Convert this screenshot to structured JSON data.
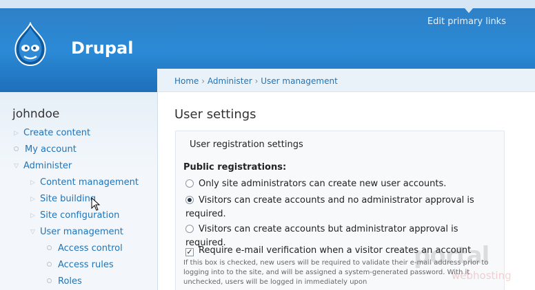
{
  "header": {
    "site_name": "Drupal",
    "primary_links_label": "Edit primary links"
  },
  "sidebar": {
    "username": "johndoe",
    "items": [
      {
        "label": "Create content",
        "bullet": "triangle-right"
      },
      {
        "label": "My account",
        "bullet": "circle"
      },
      {
        "label": "Administer",
        "bullet": "triangle-down"
      },
      {
        "label": "Content management",
        "bullet": "triangle-right"
      },
      {
        "label": "Site building",
        "bullet": "triangle-right"
      },
      {
        "label": "Site configuration",
        "bullet": "triangle-right"
      },
      {
        "label": "User management",
        "bullet": "triangle-down"
      },
      {
        "label": "Access control",
        "bullet": "circle"
      },
      {
        "label": "Access rules",
        "bullet": "circle"
      },
      {
        "label": "Roles",
        "bullet": "circle"
      }
    ]
  },
  "breadcrumb": {
    "items": [
      "Home",
      "Administer",
      "User management"
    ],
    "separator": "›"
  },
  "main": {
    "title": "User settings",
    "fieldset_legend": "User registration settings",
    "public_registrations_label": "Public registrations:",
    "options": [
      {
        "label": "Only site administrators can create new user accounts.",
        "checked": false
      },
      {
        "label": "Visitors can create accounts and no administrator approval is required.",
        "checked": true
      },
      {
        "label": "Visitors can create accounts but administrator approval is required.",
        "checked": false
      }
    ],
    "email_verification_label": "Require e-mail verification when a visitor creates an account",
    "email_verification_checked": true,
    "email_verification_desc": "If this box is checked, new users will be required to validate their e-mail address prior to logging into to the site, and will be assigned a system-generated password. With it unchecked, users will be logged in immediately upon"
  },
  "watermark": {
    "main": "portal",
    "sub": "webhosting"
  },
  "colors": {
    "header_blue": "#2b8ad6",
    "link_blue": "#1f73b6"
  }
}
